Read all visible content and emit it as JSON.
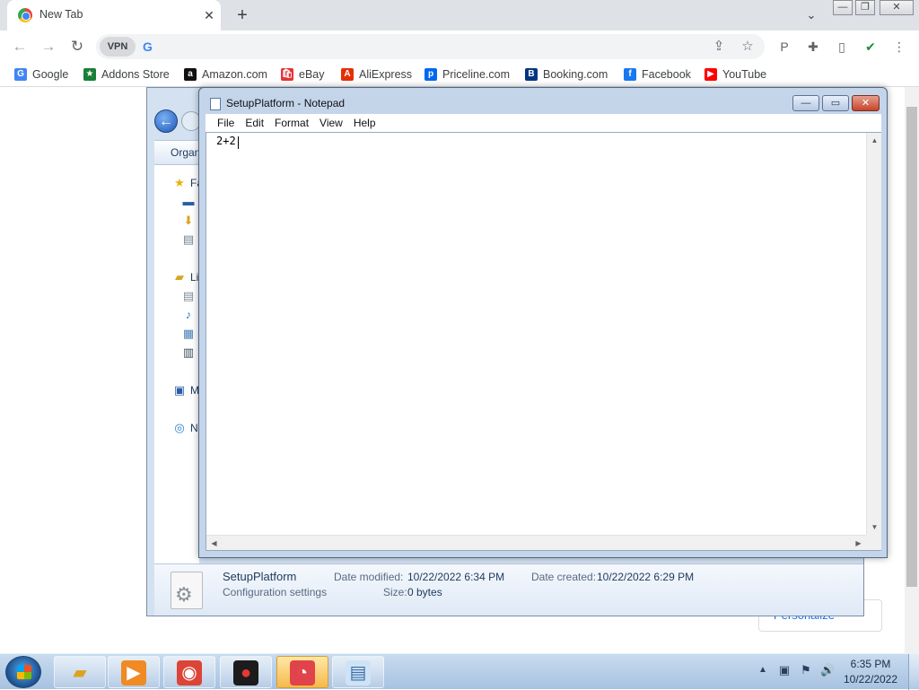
{
  "browser": {
    "tab": {
      "title": "New Tab",
      "close": "✕"
    },
    "new_tab": "+",
    "tab_search": "⌄",
    "window_controls": {
      "minimize": "—",
      "maximize": "❐",
      "close": "✕"
    },
    "nav": {
      "back": "←",
      "forward": "→",
      "reload": "↻"
    },
    "omnibox": {
      "vpn_label": "VPN",
      "engine_glyph": "G",
      "value": "",
      "share_icon": "share-icon",
      "star_icon": "bookmark-star-icon"
    },
    "extensions": [
      {
        "name": "privacy-badge-icon",
        "glyph": "P",
        "color": "#5f6368"
      },
      {
        "name": "puzzle-icon",
        "glyph": "✚",
        "color": "#5f6368"
      },
      {
        "name": "sidebar-icon",
        "glyph": "▯",
        "color": "#5f6368"
      },
      {
        "name": "shield-check-icon",
        "glyph": "✔",
        "color": "#1e8e3e"
      },
      {
        "name": "kebab-menu-icon",
        "glyph": "⋮",
        "color": "#5f6368"
      }
    ],
    "bookmarks": [
      {
        "label": "Google",
        "glyph": "G",
        "color": "#4285f4"
      },
      {
        "label": "Addons Store",
        "glyph": "★",
        "color": "#188038"
      },
      {
        "label": "Amazon.com",
        "glyph": "a",
        "color": "#111111"
      },
      {
        "label": "eBay",
        "glyph": "🛍",
        "color": "#e53238"
      },
      {
        "label": "AliExpress",
        "glyph": "A",
        "color": "#e62e04"
      },
      {
        "label": "Priceline.com",
        "glyph": "p",
        "color": "#0068ef"
      },
      {
        "label": "Booking.com",
        "glyph": "B",
        "color": "#003580"
      },
      {
        "label": "Facebook",
        "glyph": "f",
        "color": "#1877f2"
      },
      {
        "label": "YouTube",
        "glyph": "▶",
        "color": "#ff0000"
      }
    ],
    "personalize_label": "Personalize"
  },
  "explorer": {
    "organize_label": "Organ",
    "sidebar": [
      {
        "label": "Fa",
        "icon": "favorites-star-icon",
        "glyph": "★",
        "color": "#e8b400"
      },
      {
        "label": "",
        "icon": "desktop-icon",
        "glyph": "▬",
        "color": "#2b5ea8"
      },
      {
        "label": "",
        "icon": "downloads-icon",
        "glyph": "⬇",
        "color": "#d9a420"
      },
      {
        "label": "",
        "icon": "recent-places-icon",
        "glyph": "▤",
        "color": "#6f7f93"
      },
      {
        "label": "Li",
        "icon": "libraries-icon",
        "glyph": "▰",
        "color": "#d9a420"
      },
      {
        "label": "",
        "icon": "documents-icon",
        "glyph": "▤",
        "color": "#7f8b99"
      },
      {
        "label": "",
        "icon": "music-icon",
        "glyph": "♪",
        "color": "#2b7bd0"
      },
      {
        "label": "",
        "icon": "pictures-icon",
        "glyph": "▦",
        "color": "#4a7fb7"
      },
      {
        "label": "",
        "icon": "videos-icon",
        "glyph": "▥",
        "color": "#3a4a60"
      },
      {
        "label": "M",
        "icon": "computer-icon",
        "glyph": "▣",
        "color": "#2b5ea8"
      },
      {
        "label": "N",
        "icon": "network-icon",
        "glyph": "◎",
        "color": "#2b7bd0"
      }
    ],
    "details": {
      "name": "SetupPlatform",
      "type": "Configuration settings",
      "modified_label": "Date modified:",
      "modified_value": "10/22/2022 6:34 PM",
      "created_label": "Date created:",
      "created_value": "10/22/2022 6:29 PM",
      "size_label": "Size:",
      "size_value": "0 bytes"
    }
  },
  "notepad": {
    "title": "SetupPlatform - Notepad",
    "menu": [
      "File",
      "Edit",
      "Format",
      "View",
      "Help"
    ],
    "content": "2+2",
    "controls": {
      "minimize": "—",
      "maximize": "▭",
      "close": "✕"
    },
    "scroll_arrows": {
      "up": "▲",
      "down": "▼",
      "left": "◀",
      "right": "▶"
    }
  },
  "taskbar": {
    "items": [
      {
        "name": "explorer-taskbar-icon",
        "glyph": "▰",
        "color": "#d9a420",
        "bg": "transparent"
      },
      {
        "name": "media-player-taskbar-icon",
        "glyph": "▶",
        "color": "#ffffff",
        "bg": "#f08a24"
      },
      {
        "name": "chrome-taskbar-icon",
        "glyph": "◉",
        "color": "#ffffff",
        "bg": "#db4437"
      },
      {
        "name": "screen-recorder-taskbar-icon",
        "glyph": "●",
        "color": "#e53935",
        "bg": "#1c1c1c"
      },
      {
        "name": "browser-active-taskbar-icon",
        "glyph": "◔",
        "color": "#ffffff",
        "bg": "#e0434a"
      },
      {
        "name": "notepad-taskbar-icon",
        "glyph": "▤",
        "color": "#3a6ea5",
        "bg": "#cfe3f7"
      }
    ],
    "tray": {
      "expand": "▲",
      "icons": [
        {
          "name": "network-tray-icon",
          "glyph": "▣"
        },
        {
          "name": "action-center-flag-icon",
          "glyph": "⚑"
        },
        {
          "name": "volume-icon",
          "glyph": "🔊"
        }
      ]
    },
    "clock": {
      "time": "6:35 PM",
      "date": "10/22/2022"
    }
  }
}
